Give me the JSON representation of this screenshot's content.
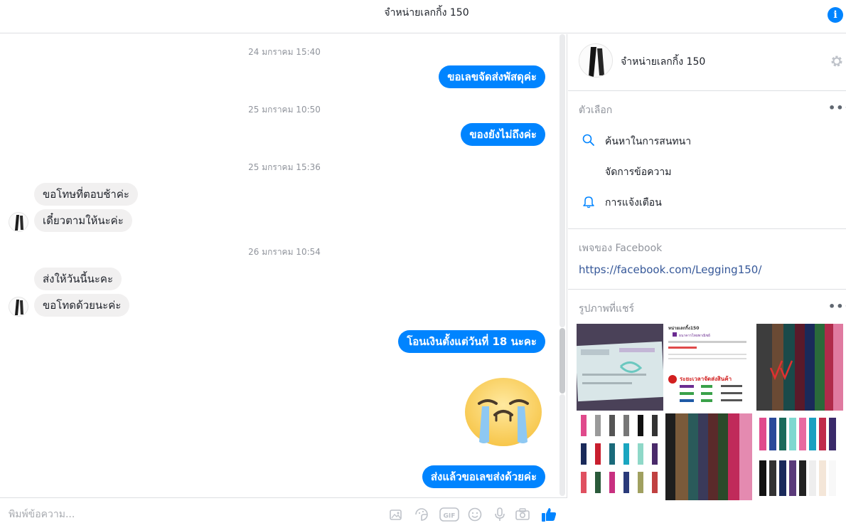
{
  "header": {
    "title": "จำหน่ายเลกกิ้ง 150",
    "info_icon": "info-icon"
  },
  "conversation": {
    "timestamps": [
      "24 มกราคม 15:40",
      "25 มกราคม 10:50",
      "25 มกราคม 15:36",
      "26 มกราคม 10:54"
    ],
    "messages": [
      {
        "direction": "out",
        "text": "ขอเลขจัดส่งพัสดุค่ะ"
      },
      {
        "direction": "out",
        "text": "ของยังไม่ถึงค่ะ"
      },
      {
        "direction": "in",
        "text": "ขอโทษที่ตอบช้าค่ะ"
      },
      {
        "direction": "in",
        "text": "เดี๋ยวตามให้นะค่ะ"
      },
      {
        "direction": "in",
        "text": "ส่งให้วันนี้นะคะ"
      },
      {
        "direction": "in",
        "text": "ขอโทดด้วยนะค่ะ"
      },
      {
        "direction": "out",
        "text": "โอนเงินตั้งแต่วันที่ 18 นะคะ"
      },
      {
        "direction": "out",
        "text": "ส่งแล้วขอเลขส่งด้วยค่ะ"
      }
    ],
    "sticker": "crying-face-sticker"
  },
  "composer": {
    "placeholder": "พิมพ์ข้อความ...",
    "icons": [
      "photo-icon",
      "sticker-icon",
      "gif-icon",
      "emoji-icon",
      "microphone-icon",
      "camera-icon",
      "like-icon"
    ],
    "gif_label": "GIF"
  },
  "panel": {
    "profile_name": "จำหน่ายเลกกิ้ง 150",
    "options_title": "ตัวเลือก",
    "options": [
      {
        "label": "ค้นหาในการสนทนา",
        "icon": "search-icon"
      },
      {
        "label": "จัดการข้อความ",
        "icon": ""
      },
      {
        "label": "การแจ้งเตือน",
        "icon": "bell-icon"
      }
    ],
    "page_title": "เพจของ Facebook",
    "page_link": "https://facebook.com/Legging150/",
    "photos_title": "รูปภาพที่แชร์",
    "more_label": "•••",
    "photo_notice": {
      "shop": "หน่ายเลกกิ้ง150",
      "bank": "ธนาคารไทยพาณิชย์",
      "schedule": "ระยะเวลาจัดส่งสินค้า"
    }
  },
  "colors": {
    "accent": "#0084ff",
    "link": "#365899"
  }
}
